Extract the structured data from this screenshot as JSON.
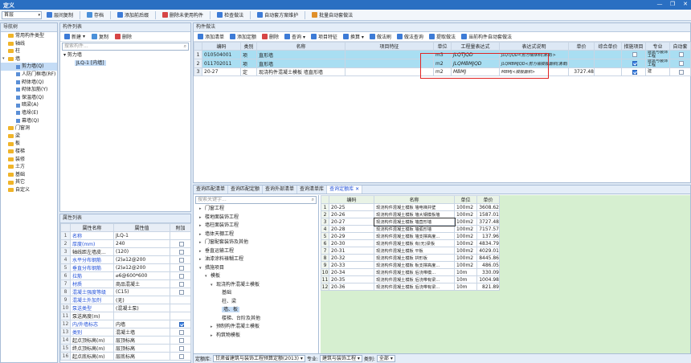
{
  "window": {
    "title": "定义",
    "minimize": "—",
    "restore": "❐",
    "close": "✕"
  },
  "toolbar": {
    "floor_select": "首层",
    "items": [
      {
        "label": "层间复制",
        "icon": "copy-floor-icon",
        "color": "#3d7bd6"
      },
      {
        "label": "存档",
        "icon": "save-icon",
        "color": "#4a90d9"
      },
      {
        "label": "添加前后缀",
        "icon": "prefix-icon",
        "color": "#3d7bd6"
      },
      {
        "label": "删除未使用构件",
        "icon": "delete-unused-icon",
        "color": "#d64545"
      },
      {
        "label": "检查做法",
        "icon": "check-icon",
        "color": "#3d7bd6"
      },
      {
        "label": "自动套方案维护",
        "icon": "scheme-icon",
        "color": "#3d7bd6"
      },
      {
        "label": "批量自动套做法",
        "icon": "batch-icon",
        "color": "#e0902a"
      }
    ]
  },
  "nav": {
    "title": "导航树",
    "items": [
      {
        "label": "常用构件类型",
        "level": 0,
        "expand": "",
        "icon": "folder"
      },
      {
        "label": "轴线",
        "level": 0,
        "expand": "",
        "icon": "folder"
      },
      {
        "label": "柱",
        "level": 0,
        "expand": "",
        "icon": "folder"
      },
      {
        "label": "墙",
        "level": 0,
        "expand": "▾",
        "icon": "folder"
      },
      {
        "label": "剪力墙(Q)",
        "level": 1,
        "expand": "",
        "icon": "wall",
        "selected": true
      },
      {
        "label": "人防门框墙(RF)",
        "level": 1,
        "expand": "",
        "icon": "wall"
      },
      {
        "label": "砌体墙(Q)",
        "level": 1,
        "expand": "",
        "icon": "wall"
      },
      {
        "label": "砌体加筋(Y)",
        "level": 1,
        "expand": "",
        "icon": "wall"
      },
      {
        "label": "保温墙(Q)",
        "level": 1,
        "expand": "",
        "icon": "wall"
      },
      {
        "label": "暗梁(A)",
        "level": 1,
        "expand": "",
        "icon": "wall"
      },
      {
        "label": "墙垛(E)",
        "level": 1,
        "expand": "",
        "icon": "wall"
      },
      {
        "label": "幕墙(Q)",
        "level": 1,
        "expand": "",
        "icon": "wall"
      },
      {
        "label": "门窗洞",
        "level": 0,
        "expand": "",
        "icon": "folder"
      },
      {
        "label": "梁",
        "level": 0,
        "expand": "",
        "icon": "folder"
      },
      {
        "label": "板",
        "level": 0,
        "expand": "",
        "icon": "folder"
      },
      {
        "label": "楼梯",
        "level": 0,
        "expand": "",
        "icon": "folder"
      },
      {
        "label": "装修",
        "level": 0,
        "expand": "",
        "icon": "folder"
      },
      {
        "label": "土方",
        "level": 0,
        "expand": "",
        "icon": "folder"
      },
      {
        "label": "基础",
        "level": 0,
        "expand": "",
        "icon": "folder"
      },
      {
        "label": "其它",
        "level": 0,
        "expand": "",
        "icon": "folder"
      },
      {
        "label": "自定义",
        "level": 0,
        "expand": "",
        "icon": "folder"
      }
    ]
  },
  "component_list": {
    "title": "构件列表",
    "new_label": "新建",
    "copy_label": "复制",
    "delete_label": "删除",
    "search_placeholder": "搜索构件...",
    "tree_root": "剪力墙",
    "tree_child": "JLQ-1 [内墙]"
  },
  "properties": {
    "title": "属性列表",
    "headers": [
      "属性名称",
      "属性值",
      "附加"
    ],
    "rows": [
      {
        "n": "1",
        "name": "名称",
        "value": "JLQ-1",
        "blue": true,
        "chk": null
      },
      {
        "n": "2",
        "name": "厚度(mm)",
        "value": "240",
        "blue": true,
        "chk": false
      },
      {
        "n": "3",
        "name": "轴线距左墙皮...",
        "value": "(120)",
        "blue": false,
        "chk": false
      },
      {
        "n": "4",
        "name": "水平分布钢筋",
        "value": "(2)⌀12@200",
        "blue": true,
        "chk": false
      },
      {
        "n": "5",
        "name": "垂直分布钢筋",
        "value": "(2)⌀12@200",
        "blue": true,
        "chk": false
      },
      {
        "n": "6",
        "name": "拉筋",
        "value": "⌀6@600*600",
        "blue": true,
        "chk": false
      },
      {
        "n": "7",
        "name": "材质",
        "value": "商品混凝土",
        "blue": true,
        "chk": false
      },
      {
        "n": "8",
        "name": "混凝土强度等级",
        "value": "(C15)",
        "blue": true,
        "chk": false
      },
      {
        "n": "9",
        "name": "混凝土外加剂",
        "value": "(无)",
        "blue": true,
        "chk": null
      },
      {
        "n": "10",
        "name": "泵送类型",
        "value": "(混凝土泵)",
        "blue": true,
        "chk": null
      },
      {
        "n": "11",
        "name": "泵送高度(m)",
        "value": "",
        "blue": false,
        "chk": null
      },
      {
        "n": "12",
        "name": "内/外墙标志",
        "value": "内墙",
        "blue": true,
        "chk": true
      },
      {
        "n": "13",
        "name": "类别",
        "value": "混凝土墙",
        "blue": true,
        "chk": false
      },
      {
        "n": "14",
        "name": "起点顶标高(m)",
        "value": "层顶标高",
        "blue": false,
        "chk": false
      },
      {
        "n": "15",
        "name": "终点顶标高(m)",
        "value": "层顶标高",
        "blue": false,
        "chk": false
      },
      {
        "n": "16",
        "name": "起点底标高(m)",
        "value": "层底标高",
        "blue": false,
        "chk": false
      }
    ]
  },
  "ops": {
    "title": "构件做法",
    "toolbar": [
      {
        "label": "添加清单",
        "color": "#3d7bd6"
      },
      {
        "label": "添加定额",
        "color": "#3d7bd6"
      },
      {
        "label": "删除",
        "color": "#d64545"
      },
      {
        "label": "查询 ▾",
        "color": "#3d7bd6"
      },
      {
        "label": "项目特征",
        "color": "#3d7bd6"
      },
      {
        "label": "换算 ▾",
        "color": "#3d7bd6"
      },
      {
        "label": "做法刷",
        "color": "#3d7bd6"
      },
      {
        "label": "做法查询",
        "color": "#3d7bd6"
      },
      {
        "label": "提取做法",
        "color": "#3d7bd6"
      },
      {
        "label": "当前构件自动套做法",
        "color": "#3d7bd6"
      }
    ],
    "headers": [
      "编码",
      "类别",
      "名称",
      "项目特征",
      "单位",
      "工程量表达式",
      "表达式说明",
      "单价",
      "综合单价",
      "措施项目",
      "专业",
      "自动套"
    ],
    "rows": [
      {
        "n": "1",
        "code": "010504001",
        "cat": "项",
        "name": "直形墙",
        "feature": "",
        "unit": "m3",
        "expr": "JLQTJQD",
        "desc": "JLQTJQD<剪力墙体积(清单)>",
        "price": "",
        "comp": "",
        "measure": false,
        "major": "建筑与装饰工程",
        "auto": false,
        "sel": true
      },
      {
        "n": "2",
        "code": "011702011",
        "cat": "项",
        "name": "直形墙",
        "feature": "",
        "unit": "m2",
        "expr": "JLQMBMJQD",
        "desc": "JLQMBMJQD<剪力墙模板面积(清单)>",
        "price": "",
        "comp": "",
        "measure": true,
        "major": "建筑与装饰工程",
        "auto": false,
        "sel": true
      },
      {
        "n": "3",
        "code": "20-27",
        "cat": "定",
        "name": "现浇构件混凝土模板 墙直形墙",
        "feature": "",
        "unit": "m2",
        "expr": "MBMJ",
        "desc": "MBMJ<模板面积>",
        "price": "3727.48",
        "comp": "",
        "measure": true,
        "major": "建",
        "auto": false,
        "sel": false
      }
    ]
  },
  "bottom": {
    "tabs": [
      {
        "label": "查询匹配清单",
        "active": false
      },
      {
        "label": "查询匹配定额",
        "active": false
      },
      {
        "label": "查询外部清单",
        "active": false
      },
      {
        "label": "查询清单库",
        "active": false
      },
      {
        "label": "查询定额库",
        "active": true
      }
    ],
    "search_placeholder": "搜索关键字...",
    "tree": [
      {
        "label": "门窗工程",
        "indent": 1,
        "exp": "▸"
      },
      {
        "label": "楼地面装饰工程",
        "indent": 1,
        "exp": "▸"
      },
      {
        "label": "墙柱面装饰工程",
        "indent": 1,
        "exp": "▸"
      },
      {
        "label": "墙体天棚工程",
        "indent": 1,
        "exp": "▸"
      },
      {
        "label": "门窗配套装饰及其他",
        "indent": 1,
        "exp": "▸"
      },
      {
        "label": "垂直运输工程",
        "indent": 1,
        "exp": "▸"
      },
      {
        "label": "油漆涂料裱糊工程",
        "indent": 1,
        "exp": "▸"
      },
      {
        "label": "措施项目",
        "indent": 1,
        "exp": "▾"
      },
      {
        "label": "模板",
        "indent": 2,
        "exp": "▾"
      },
      {
        "label": "现浇构件混凝土模板",
        "indent": 3,
        "exp": "▾"
      },
      {
        "label": "基础",
        "indent": 4,
        "exp": ""
      },
      {
        "label": "柱、梁",
        "indent": 4,
        "exp": ""
      },
      {
        "label": "墙、板",
        "indent": 4,
        "exp": "",
        "sel": true
      },
      {
        "label": "楼梯、台阶及其他",
        "indent": 4,
        "exp": ""
      },
      {
        "label": "预制构件混凝土模板",
        "indent": 3,
        "exp": "▸"
      },
      {
        "label": "构筑物模板",
        "indent": 3,
        "exp": "▸"
      }
    ],
    "grid_headers": [
      "编码",
      "名称",
      "单位",
      "单价"
    ],
    "grid_rows": [
      {
        "n": "1",
        "code": "20-25",
        "name": "现浇构件混凝土模板 墙电梯井壁",
        "unit": "100m2",
        "price": "3608.62"
      },
      {
        "n": "2",
        "code": "20-26",
        "name": "现浇构件混凝土模板 墙大钢模板墙",
        "unit": "100m2",
        "price": "1587.01"
      },
      {
        "n": "3",
        "code": "20-27",
        "name": "现浇构件混凝土模板 墙直形墙",
        "unit": "100m2",
        "price": "3727.48"
      },
      {
        "n": "4",
        "code": "20-28",
        "name": "现浇构件混凝土模板 墙弧形墙",
        "unit": "100m2",
        "price": "7157.57"
      },
      {
        "n": "5",
        "code": "20-29",
        "name": "现浇构件混凝土模板 墙支撑高度…",
        "unit": "100m2",
        "price": "137.96"
      },
      {
        "n": "6",
        "code": "20-30",
        "name": "现浇构件混凝土模板 有(无)梁板",
        "unit": "100m2",
        "price": "4834.79"
      },
      {
        "n": "7",
        "code": "20-31",
        "name": "现浇构件混凝土模板 平板",
        "unit": "100m2",
        "price": "4029.01"
      },
      {
        "n": "8",
        "code": "20-32",
        "name": "现浇构件混凝土模板 拱形板",
        "unit": "100m2",
        "price": "8445.86"
      },
      {
        "n": "9",
        "code": "20-33",
        "name": "现浇构件混凝土模板 板支撑高度…",
        "unit": "100m2",
        "price": "486.05"
      },
      {
        "n": "10",
        "code": "20-34",
        "name": "现浇构件混凝土模板 后浇带模…",
        "unit": "10m",
        "price": "330.09"
      },
      {
        "n": "11",
        "code": "20-35",
        "name": "现浇构件混凝土模板 后浇带有梁…",
        "unit": "10m",
        "price": "1004.98"
      },
      {
        "n": "12",
        "code": "20-36",
        "name": "现浇构件混凝土模板 后浇带有梁…",
        "unit": "10m",
        "price": "821.89"
      }
    ],
    "status": {
      "lib_label": "定额库:",
      "lib_value": "甘肃省建筑与装饰工程预算定额(2013)",
      "major_label": "专业:",
      "major_value": "建筑与装饰工程",
      "cat_label": "类别:",
      "cat_value": "全部"
    }
  }
}
